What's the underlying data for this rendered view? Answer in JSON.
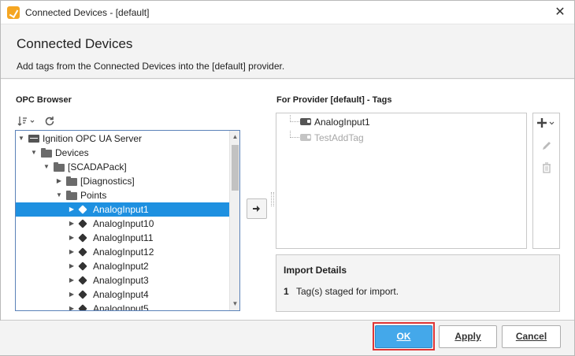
{
  "window": {
    "title": "Connected Devices - [default]",
    "close_glyph": "✕"
  },
  "header": {
    "title": "Connected Devices",
    "subtitle": "Add tags from the Connected Devices into the [default] provider."
  },
  "opc": {
    "label": "OPC Browser",
    "toolbar_icons": [
      "sort-icon",
      "refresh-icon"
    ],
    "tree": [
      {
        "label": "Ignition OPC UA Server",
        "icon": "server-icon",
        "expanded": true
      },
      {
        "label": "Devices",
        "icon": "folder-icon",
        "expanded": true
      },
      {
        "label": "[SCADAPack]",
        "icon": "folder-icon",
        "expanded": true
      },
      {
        "label": "[Diagnostics]",
        "icon": "folder-icon",
        "expanded": false
      },
      {
        "label": "Points",
        "icon": "folder-icon",
        "expanded": true
      },
      {
        "label": "AnalogInput1",
        "icon": "tag-icon",
        "selected": true
      },
      {
        "label": "AnalogInput10",
        "icon": "tag-icon"
      },
      {
        "label": "AnalogInput11",
        "icon": "tag-icon"
      },
      {
        "label": "AnalogInput12",
        "icon": "tag-icon"
      },
      {
        "label": "AnalogInput2",
        "icon": "tag-icon"
      },
      {
        "label": "AnalogInput3",
        "icon": "tag-icon"
      },
      {
        "label": "AnalogInput4",
        "icon": "tag-icon"
      },
      {
        "label": "AnalogInput5",
        "icon": "tag-icon"
      }
    ]
  },
  "provider": {
    "label": "For Provider [default] - Tags",
    "tags": [
      {
        "label": "AnalogInput1",
        "faded": false
      },
      {
        "label": "TestAddTag",
        "faded": true
      }
    ],
    "tool_icons": [
      "add-icon",
      "edit-icon",
      "delete-icon"
    ]
  },
  "import": {
    "title": "Import Details",
    "count": "1",
    "message": "Tag(s) staged for import."
  },
  "buttons": {
    "ok": "OK",
    "apply": "Apply",
    "cancel": "Cancel"
  }
}
